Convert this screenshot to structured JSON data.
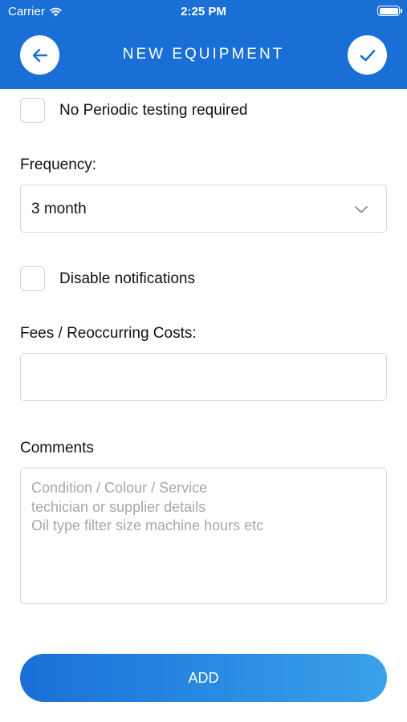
{
  "status_bar": {
    "carrier": "Carrier",
    "time": "2:25 PM"
  },
  "nav": {
    "title": "NEW EQUIPMENT",
    "back_icon": "arrow-left-icon",
    "done_icon": "checkmark-icon"
  },
  "form": {
    "no_periodic_testing": {
      "label": "No Periodic testing required",
      "checked": false
    },
    "frequency": {
      "label": "Frequency:",
      "value": "3 month"
    },
    "disable_notifications": {
      "label": "Disable notifications",
      "checked": false
    },
    "fees": {
      "label": "Fees / Reoccurring Costs:",
      "value": ""
    },
    "comments": {
      "label": "Comments",
      "placeholder_lines": [
        "Condition / Colour / Service",
        "techician or supplier details",
        "Oil type filter size machine hours etc"
      ]
    },
    "add_button": "ADD"
  },
  "colors": {
    "primary": "#1a6fd6",
    "gradient_end": "#3aa1ea",
    "placeholder": "#a8a8a8",
    "border": "#d6d6d6"
  }
}
